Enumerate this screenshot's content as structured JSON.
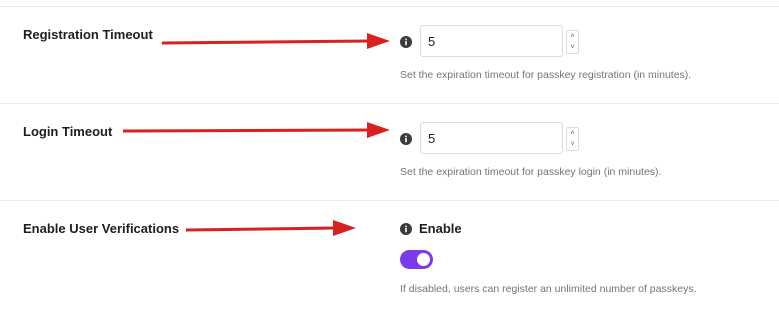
{
  "settings": [
    {
      "label": "Registration Timeout",
      "value": "5",
      "help": "Set the expiration timeout for passkey registration (in minutes)."
    },
    {
      "label": "Login Timeout",
      "value": "5",
      "help": "Set the expiration timeout for passkey login (in minutes)."
    },
    {
      "label": "Enable User Verifications",
      "option_label": "Enable",
      "enabled": true,
      "help": "If disabled, users can register an unlimited number of passkeys."
    }
  ],
  "spinner": {
    "up": "˄",
    "down": "˅"
  },
  "icons": {
    "info": "info-icon",
    "arrow": "arrow-right-icon"
  },
  "colors": {
    "arrow": "#d92121",
    "toggle_on": "#7c3aed",
    "info_icon": "#3a3a3a",
    "label": "#1e1e1e",
    "help": "#757575"
  }
}
